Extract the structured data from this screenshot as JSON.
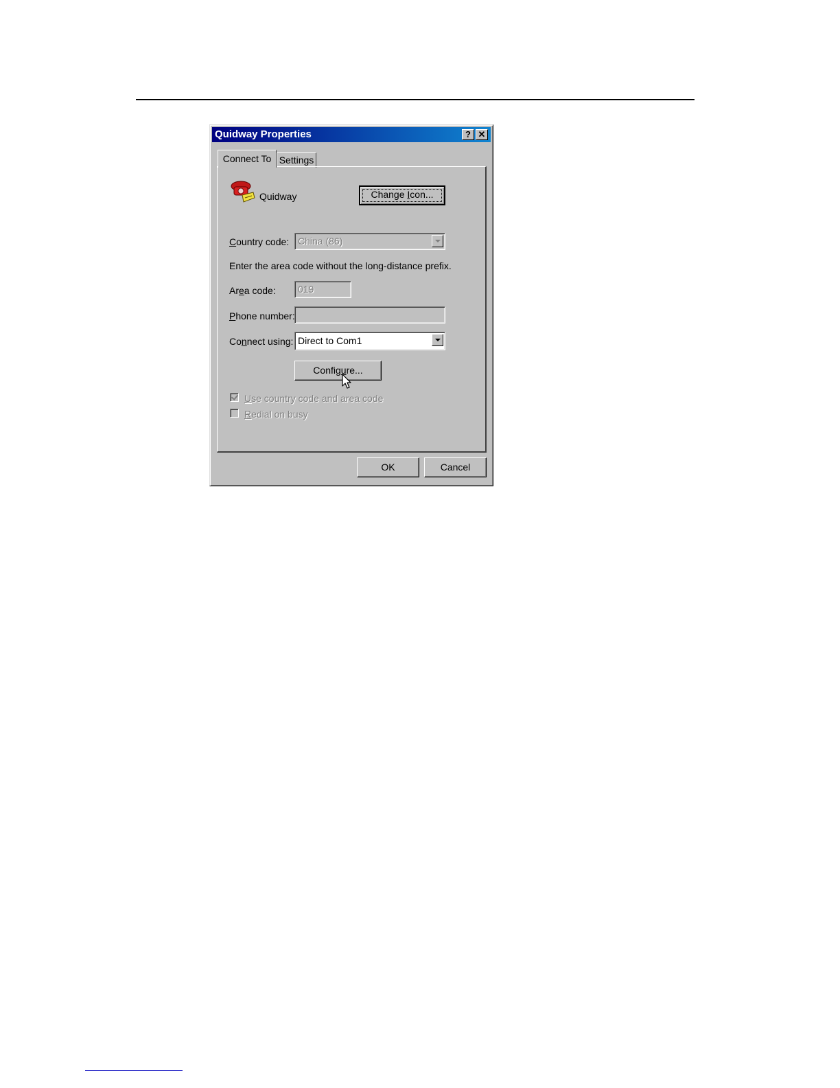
{
  "dialog": {
    "title": "Quidway Properties",
    "help_glyph": "?",
    "close_glyph": "✕"
  },
  "tabs": [
    {
      "label": "Connect To",
      "active": true
    },
    {
      "label": "Settings",
      "active": false
    }
  ],
  "connection": {
    "name": "Quidway",
    "icon": "telephone-icon",
    "change_icon_button": {
      "label": "Change ",
      "mnemonic": "I",
      "rest": "con..."
    }
  },
  "fields": {
    "country_code": {
      "label_mn": "C",
      "label_rest": "ountry code:",
      "value": "China (86)",
      "disabled": true
    },
    "area_hint": "Enter the area code without the long-distance prefix.",
    "area_code": {
      "label_a": "Ar",
      "label_mn": "e",
      "label_rest": "a code:",
      "value": "019",
      "disabled": true
    },
    "phone_number": {
      "label_mn": "P",
      "label_rest": "hone number:",
      "value": ""
    },
    "connect_using": {
      "label_a": "Co",
      "label_mn": "n",
      "label_rest": "nect using:",
      "value": "Direct to Com1"
    }
  },
  "configure_button": {
    "label_a": "Config",
    "label_mn": "u",
    "label_rest": "re..."
  },
  "checkboxes": [
    {
      "label_mn": "U",
      "label_rest": "se country code and area code",
      "checked": true,
      "disabled": true
    },
    {
      "label_mn": "R",
      "label_rest": "edial on busy",
      "checked": false,
      "disabled": true
    }
  ],
  "footer": {
    "ok_label": "OK",
    "cancel_label": "Cancel"
  },
  "colors": {
    "title_start": "#000080",
    "title_end": "#1084d0",
    "face": "#c0c0c0"
  }
}
